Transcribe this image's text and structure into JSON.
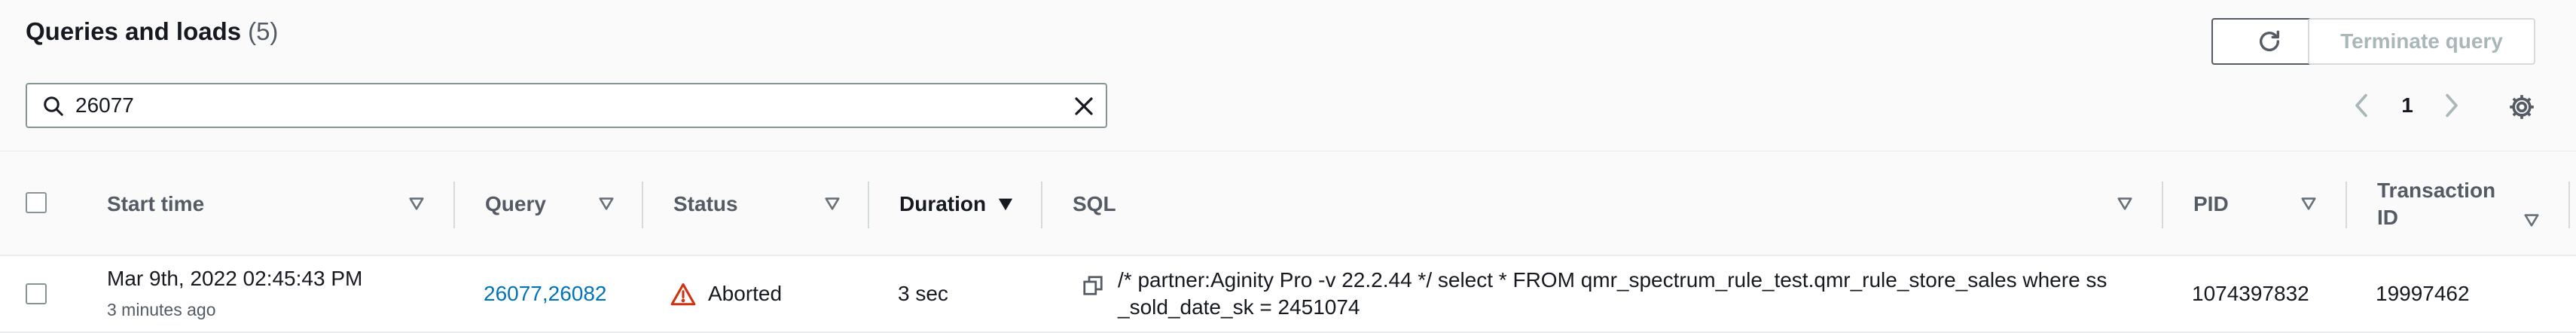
{
  "header": {
    "title": "Queries and loads",
    "count": "(5)",
    "terminate_label": "Terminate query"
  },
  "icons": {
    "refresh": "refresh-icon",
    "search": "search-icon",
    "clear": "close-icon",
    "prev": "chevron-left-icon",
    "next": "chevron-right-icon",
    "settings": "gear-icon",
    "copy": "copy-icon",
    "warning": "warning-icon"
  },
  "search": {
    "value": "26077"
  },
  "pagination": {
    "current_page": "1"
  },
  "table": {
    "columns": {
      "start_time": "Start time",
      "query": "Query",
      "status": "Status",
      "duration": "Duration",
      "sql": "SQL",
      "pid": "PID",
      "transaction_line1": "Transaction",
      "transaction_line2": "ID"
    },
    "rows": [
      {
        "start_time": "Mar 9th, 2022 02:45:43 PM",
        "relative_time": "3 minutes ago",
        "query": "26077,26082",
        "status": "Aborted",
        "duration": "3 sec",
        "sql": "/* partner:Aginity Pro -v 22.2.44 */ select * FROM qmr_spectrum_rule_test.qmr_rule_store_sales where ss _sold_date_sk = 2451074",
        "pid": "1074397832",
        "transaction_id": "19997462"
      }
    ]
  },
  "colors": {
    "link": "#0073bb",
    "warning": "#d13212",
    "border": "#eaeded",
    "disabled_text": "#aab7b8"
  }
}
